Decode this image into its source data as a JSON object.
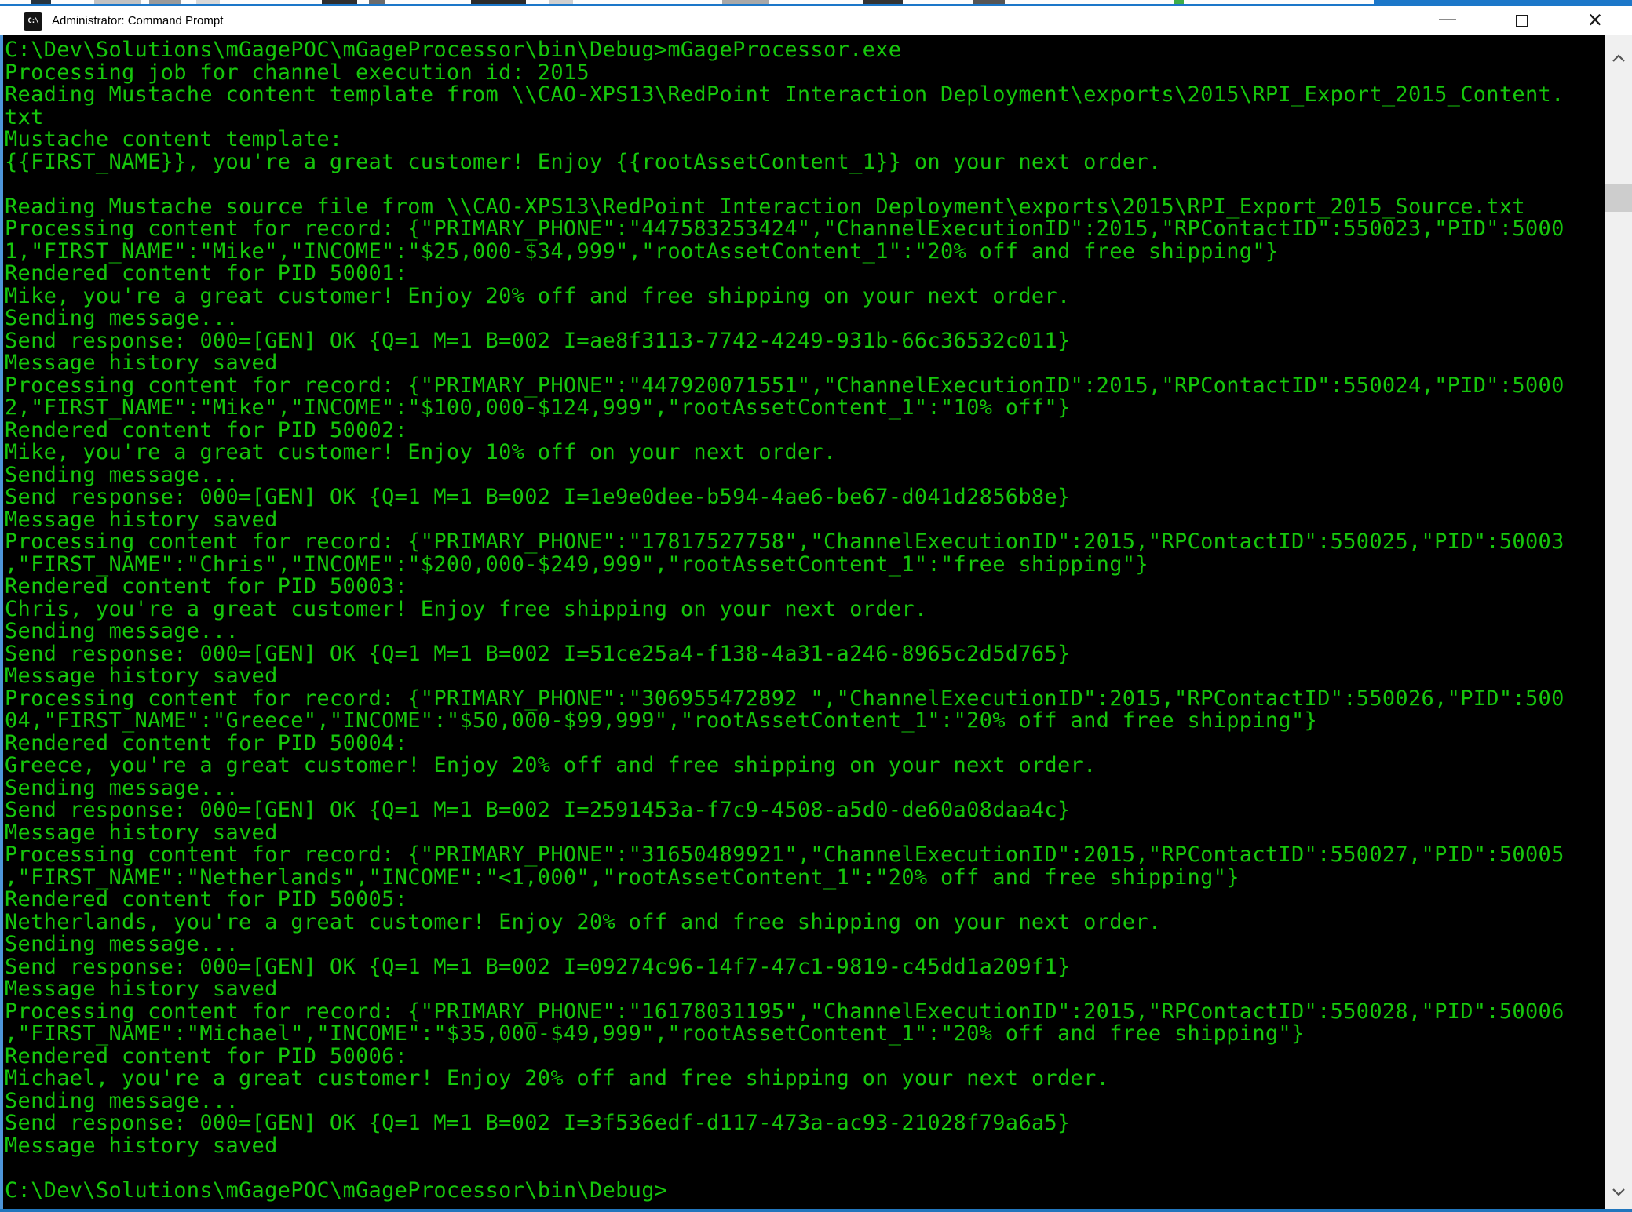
{
  "window": {
    "title": "Administrator: Command Prompt",
    "icon_label": "C:\\",
    "controls": {
      "minimize": "—",
      "close": "×"
    }
  },
  "icons": {
    "title_icon": "cmd-prompt-icon",
    "minimize": "minimize-icon",
    "maximize": "maximize-icon",
    "close": "close-icon",
    "scroll_up": "chevron-up-icon",
    "scroll_down": "chevron-down-icon"
  },
  "console": {
    "colors": {
      "background": "#000000",
      "text": "#16c60c"
    },
    "lines": [
      "C:\\Dev\\Solutions\\mGagePOC\\mGageProcessor\\bin\\Debug>mGageProcessor.exe",
      "Processing job for channel execution id: 2015",
      "Reading Mustache content template from \\\\CAO-XPS13\\RedPoint Interaction Deployment\\exports\\2015\\RPI_Export_2015_Content.",
      "txt",
      "Mustache content template:",
      "{{FIRST_NAME}}, you're a great customer! Enjoy {{rootAssetContent_1}} on your next order.",
      "",
      "Reading Mustache source file from \\\\CAO-XPS13\\RedPoint Interaction Deployment\\exports\\2015\\RPI_Export_2015_Source.txt",
      "Processing content for record: {\"PRIMARY_PHONE\":\"447583253424\",\"ChannelExecutionID\":2015,\"RPContactID\":550023,\"PID\":5000",
      "1,\"FIRST_NAME\":\"Mike\",\"INCOME\":\"$25,000-$34,999\",\"rootAssetContent_1\":\"20% off and free shipping\"}",
      "Rendered content for PID 50001:",
      "Mike, you're a great customer! Enjoy 20% off and free shipping on your next order.",
      "Sending message...",
      "Send response: 000=[GEN] OK {Q=1 M=1 B=002 I=ae8f3113-7742-4249-931b-66c36532c011}",
      "Message history saved",
      "Processing content for record: {\"PRIMARY_PHONE\":\"447920071551\",\"ChannelExecutionID\":2015,\"RPContactID\":550024,\"PID\":5000",
      "2,\"FIRST_NAME\":\"Mike\",\"INCOME\":\"$100,000-$124,999\",\"rootAssetContent_1\":\"10% off\"}",
      "Rendered content for PID 50002:",
      "Mike, you're a great customer! Enjoy 10% off on your next order.",
      "Sending message...",
      "Send response: 000=[GEN] OK {Q=1 M=1 B=002 I=1e9e0dee-b594-4ae6-be67-d041d2856b8e}",
      "Message history saved",
      "Processing content for record: {\"PRIMARY_PHONE\":\"17817527758\",\"ChannelExecutionID\":2015,\"RPContactID\":550025,\"PID\":50003",
      ",\"FIRST_NAME\":\"Chris\",\"INCOME\":\"$200,000-$249,999\",\"rootAssetContent_1\":\"free shipping\"}",
      "Rendered content for PID 50003:",
      "Chris, you're a great customer! Enjoy free shipping on your next order.",
      "Sending message...",
      "Send response: 000=[GEN] OK {Q=1 M=1 B=002 I=51ce25a4-f138-4a31-a246-8965c2d5d765}",
      "Message history saved",
      "Processing content for record: {\"PRIMARY_PHONE\":\"306955472892 \",\"ChannelExecutionID\":2015,\"RPContactID\":550026,\"PID\":500",
      "04,\"FIRST_NAME\":\"Greece\",\"INCOME\":\"$50,000-$99,999\",\"rootAssetContent_1\":\"20% off and free shipping\"}",
      "Rendered content for PID 50004:",
      "Greece, you're a great customer! Enjoy 20% off and free shipping on your next order.",
      "Sending message...",
      "Send response: 000=[GEN] OK {Q=1 M=1 B=002 I=2591453a-f7c9-4508-a5d0-de60a08daa4c}",
      "Message history saved",
      "Processing content for record: {\"PRIMARY_PHONE\":\"31650489921\",\"ChannelExecutionID\":2015,\"RPContactID\":550027,\"PID\":50005",
      ",\"FIRST_NAME\":\"Netherlands\",\"INCOME\":\"<1,000\",\"rootAssetContent_1\":\"20% off and free shipping\"}",
      "Rendered content for PID 50005:",
      "Netherlands, you're a great customer! Enjoy 20% off and free shipping on your next order.",
      "Sending message...",
      "Send response: 000=[GEN] OK {Q=1 M=1 B=002 I=09274c96-14f7-47c1-9819-c45dd1a209f1}",
      "Message history saved",
      "Processing content for record: {\"PRIMARY_PHONE\":\"16178031195\",\"ChannelExecutionID\":2015,\"RPContactID\":550028,\"PID\":50006",
      ",\"FIRST_NAME\":\"Michael\",\"INCOME\":\"$35,000-$49,999\",\"rootAssetContent_1\":\"20% off and free shipping\"}",
      "Rendered content for PID 50006:",
      "Michael, you're a great customer! Enjoy 20% off and free shipping on your next order.",
      "Sending message...",
      "Send response: 000=[GEN] OK {Q=1 M=1 B=002 I=3f536edf-d117-473a-ac93-21028f79a6a5}",
      "Message history saved",
      "",
      "C:\\Dev\\Solutions\\mGagePOC\\mGageProcessor\\bin\\Debug>"
    ]
  }
}
